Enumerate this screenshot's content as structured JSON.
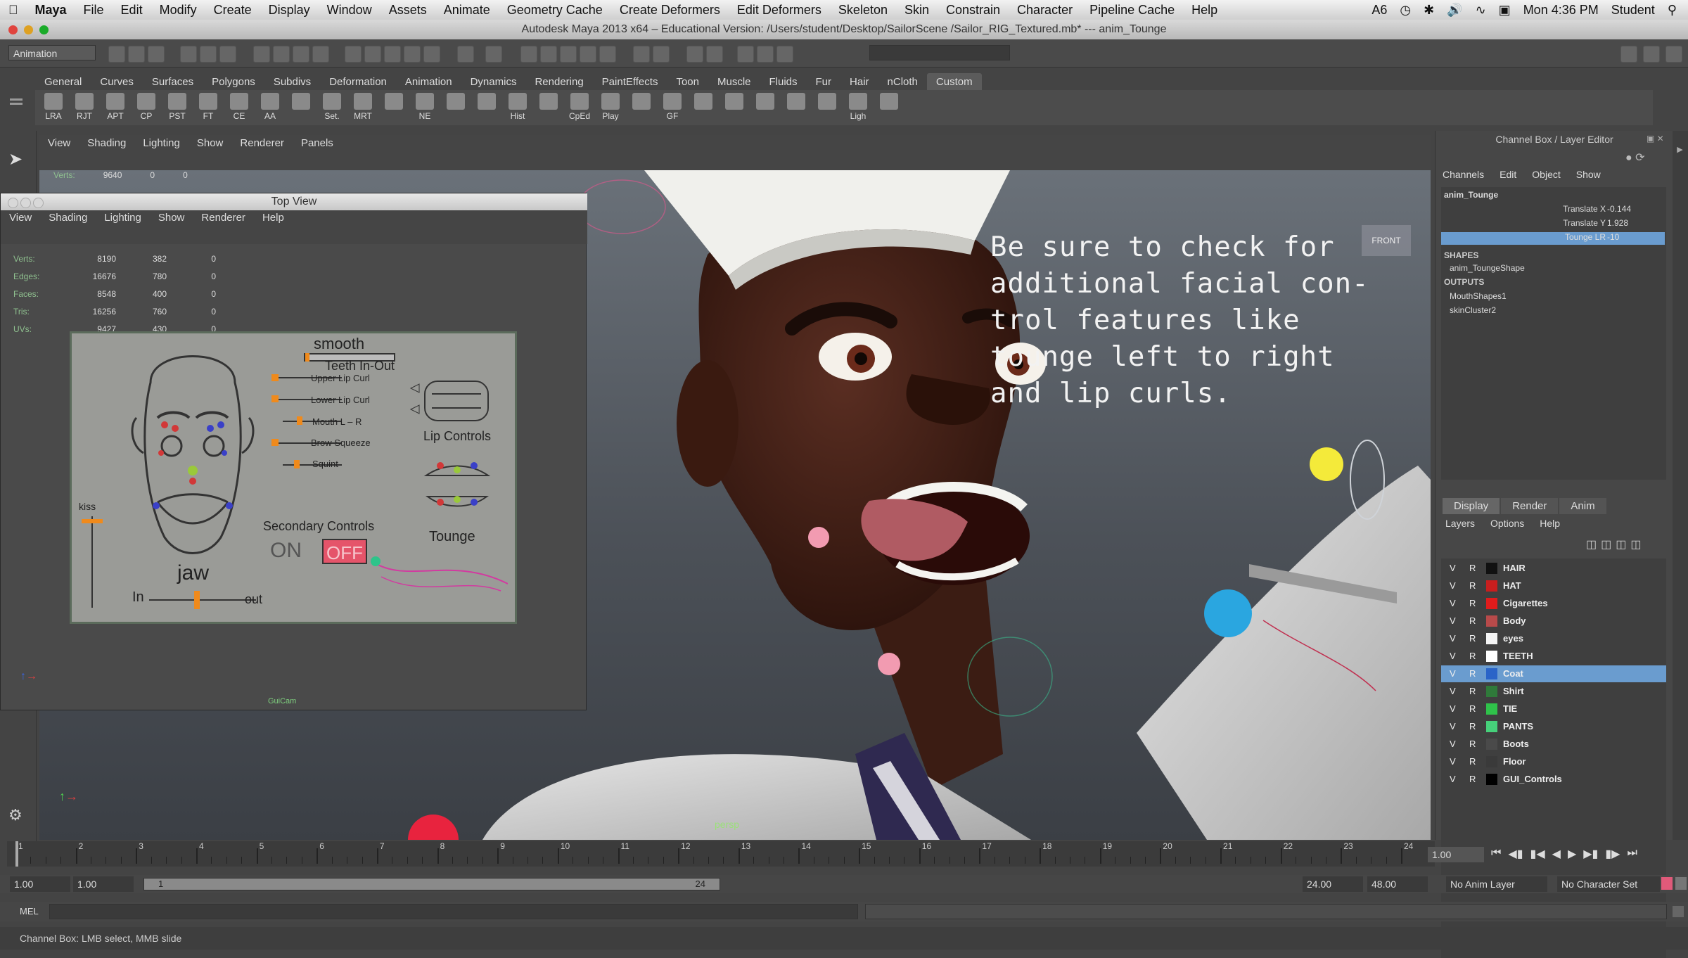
{
  "menubar": {
    "app": "Maya",
    "items": [
      "File",
      "Edit",
      "Modify",
      "Create",
      "Display",
      "Window",
      "Assets",
      "Animate",
      "Geometry Cache",
      "Create Deformers",
      "Edit Deformers",
      "Skeleton",
      "Skin",
      "Constrain",
      "Character",
      "Pipeline Cache",
      "Help"
    ],
    "clock": "Mon 4:36 PM",
    "user": "Student",
    "badge": "6"
  },
  "window_title": "Autodesk Maya 2013 x64 – Educational Version: /Users/student/Desktop/SailorScene /Sailor_RIG_Textured.mb*   ---   anim_Tounge",
  "status_line": {
    "mode": "Animation"
  },
  "shelf": {
    "tabs": [
      "General",
      "Curves",
      "Surfaces",
      "Polygons",
      "Subdivs",
      "Deformation",
      "Animation",
      "Dynamics",
      "Rendering",
      "PaintEffects",
      "Toon",
      "Muscle",
      "Fluids",
      "Fur",
      "Hair",
      "nCloth",
      "Custom"
    ],
    "active_tab": "Custom",
    "buttons": [
      "LRA",
      "RJT",
      "APT",
      "CP",
      "PST",
      "FT",
      "CE",
      "AA",
      "",
      "Set.",
      "MRT",
      "",
      "NE",
      "",
      "",
      "Hist",
      "",
      "CpEd",
      "Play",
      "",
      "GF",
      "",
      "",
      "",
      "",
      "",
      "Ligh",
      ""
    ]
  },
  "viewport": {
    "menu": [
      "View",
      "Shading",
      "Lighting",
      "Show",
      "Renderer",
      "Panels"
    ],
    "hud": {
      "verts_label": "Verts:",
      "verts_value": "9640",
      "v2": "0",
      "v3": "0"
    },
    "overlay_text": [
      "Be sure to check for",
      "additional facial con-",
      "trol features like",
      "tounge left to right",
      "and lip curls."
    ],
    "camera_label": "persp",
    "view_cube": "FRONT"
  },
  "top_view": {
    "title": "Top View",
    "menu": [
      "View",
      "Shading",
      "Lighting",
      "Show",
      "Renderer",
      "Help"
    ],
    "hud": [
      {
        "k": "Verts:",
        "a": "8190",
        "b": "382",
        "c": "0"
      },
      {
        "k": "Edges:",
        "a": "16676",
        "b": "780",
        "c": "0"
      },
      {
        "k": "Faces:",
        "a": "8548",
        "b": "400",
        "c": "0"
      },
      {
        "k": "Tris:",
        "a": "16256",
        "b": "760",
        "c": "0"
      },
      {
        "k": "UVs:",
        "a": "9427",
        "b": "430",
        "c": "0"
      }
    ],
    "footer": "GuiCam",
    "gui": {
      "smooth": "smooth",
      "sliders": [
        "Upper Lip Curl",
        "Lower Lip Curl",
        "Mouth L – R",
        "Brow Squeeze",
        "Squint"
      ],
      "teeth": "Teeth In-Out",
      "lip": "Lip Controls",
      "secondary": "Secondary Controls",
      "on": "ON",
      "off": "OFF",
      "tounge": "Tounge",
      "kiss": "kiss",
      "jaw": "jaw",
      "in": "In",
      "out": "out"
    }
  },
  "channel_box": {
    "title": "Channel Box / Layer Editor",
    "menu": [
      "Channels",
      "Edit",
      "Object",
      "Show"
    ],
    "object": "anim_Tounge",
    "attrs": [
      {
        "name": "Translate X",
        "value": "-0.144"
      },
      {
        "name": "Translate Y",
        "value": "1.928"
      },
      {
        "name": "Tounge LR",
        "value": "-10"
      }
    ],
    "shapes_hdr": "SHAPES",
    "shape": "anim_ToungeShape",
    "outputs_hdr": "OUTPUTS",
    "outputs": [
      "MouthShapes1",
      "skinCluster2"
    ]
  },
  "layer_editor": {
    "tabs": [
      "Display",
      "Render",
      "Anim"
    ],
    "menu": [
      "Layers",
      "Options",
      "Help"
    ],
    "layers": [
      {
        "name": "HAIR",
        "color": "#111111"
      },
      {
        "name": "HAT",
        "color": "#c81e1e"
      },
      {
        "name": "Cigarettes",
        "color": "#e01c1c"
      },
      {
        "name": "Body",
        "color": "#b84a4a"
      },
      {
        "name": "eyes",
        "color": "#f4f4f4"
      },
      {
        "name": "TEETH",
        "color": "#ffffff"
      },
      {
        "name": "Coat",
        "color": "#2a64c8"
      },
      {
        "name": "Shirt",
        "color": "#2f7a3a"
      },
      {
        "name": "TIE",
        "color": "#2fc24a"
      },
      {
        "name": "PANTS",
        "color": "#46d07a"
      },
      {
        "name": "Boots",
        "color": "#4a4a4a"
      },
      {
        "name": "Floor",
        "color": "#3a3a3a"
      },
      {
        "name": "GUI_Controls",
        "color": "#000000"
      }
    ],
    "selected": "Coat",
    "v": "V",
    "r": "R"
  },
  "timeline": {
    "ticks": [
      "1",
      "2",
      "3",
      "4",
      "5",
      "6",
      "7",
      "8",
      "9",
      "10",
      "11",
      "12",
      "13",
      "14",
      "15",
      "16",
      "17",
      "18",
      "19",
      "20",
      "21",
      "22",
      "23",
      "24"
    ],
    "current": "1.00"
  },
  "range": {
    "start": "1.00",
    "start2": "1.00",
    "slider_start": "1",
    "slider_end": "24",
    "end": "24.00",
    "end2": "48.00",
    "anim_layer": "No Anim Layer",
    "char_set": "No Character Set"
  },
  "command_line": {
    "label": "MEL"
  },
  "help_line": "Channel Box: LMB select, MMB slide"
}
